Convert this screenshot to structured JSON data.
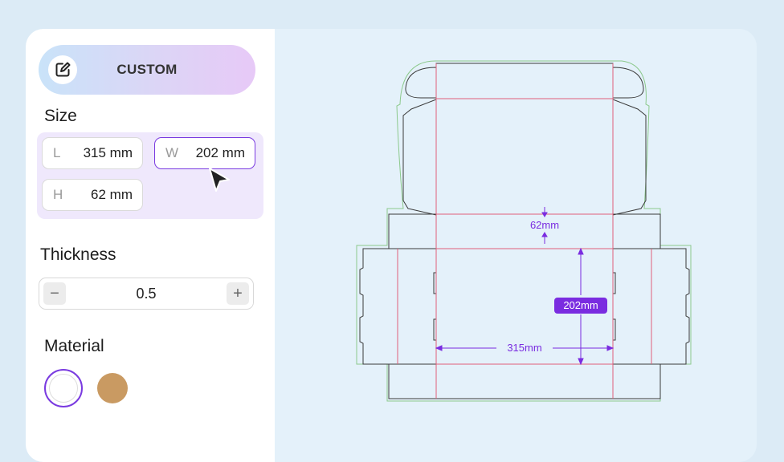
{
  "mode": {
    "label": "CUSTOM",
    "icon": "edit-icon"
  },
  "size": {
    "title": "Size",
    "length": {
      "axis": "L",
      "value": "315 mm"
    },
    "width": {
      "axis": "W",
      "value": "202 mm"
    },
    "height": {
      "axis": "H",
      "value": "62 mm"
    }
  },
  "thickness": {
    "title": "Thickness",
    "value": "0.5",
    "decrement": "−",
    "increment": "+"
  },
  "material": {
    "title": "Material",
    "options": [
      {
        "name": "white",
        "color": "#ffffff",
        "selected": true
      },
      {
        "name": "kraft",
        "color": "#c99a62",
        "selected": false
      }
    ]
  },
  "dieline": {
    "height_label": "62mm",
    "width_label": "202mm",
    "length_label": "315mm"
  },
  "colors": {
    "accent": "#7a3be0",
    "cut_line": "#333333",
    "fold_line": "#e0607a",
    "bleed_line": "#8cc98c"
  }
}
